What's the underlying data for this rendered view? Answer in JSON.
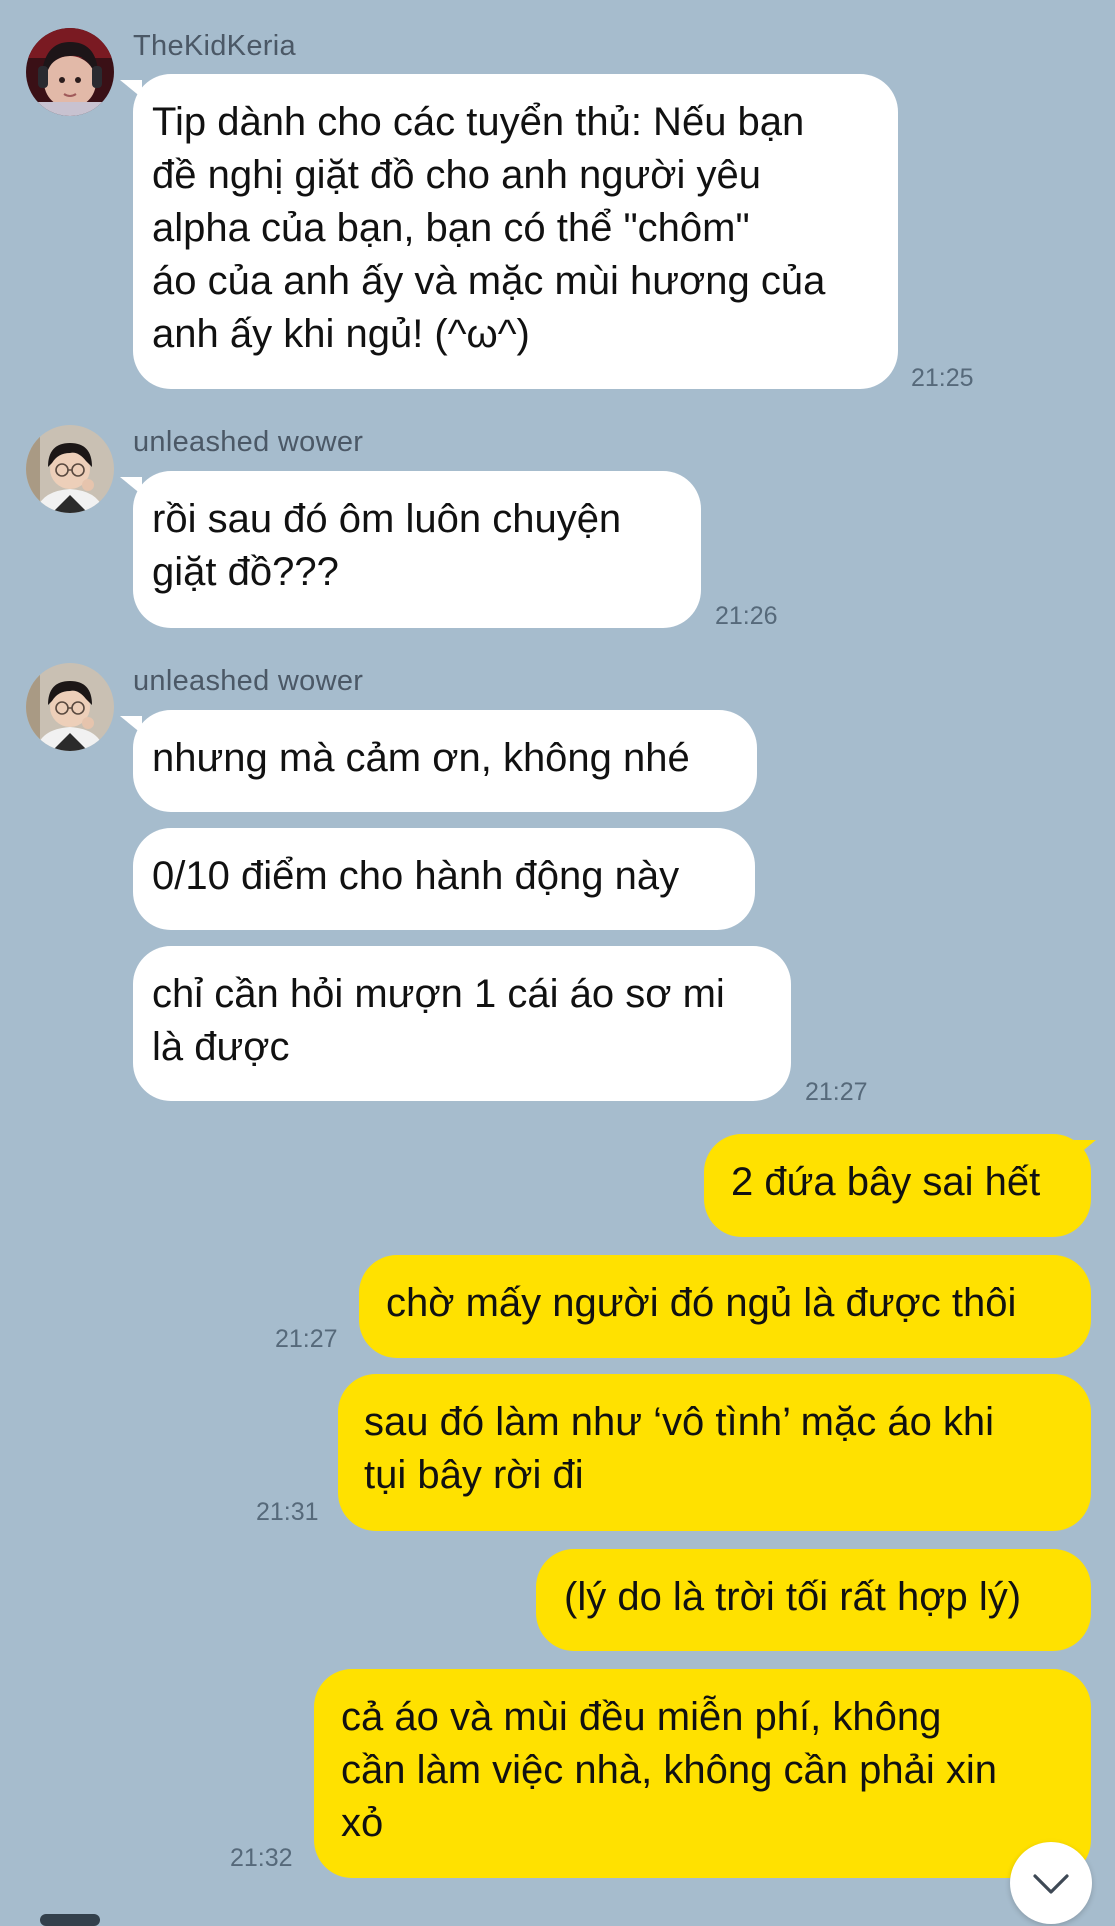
{
  "chat": {
    "thread_1": {
      "sender": "TheKidKeria",
      "text": "Tip dành cho các tuyển thủ: Nếu bạn\nđề nghị giặt đồ cho anh người yêu\nalpha của bạn, bạn có thể \"chôm\"\náo của anh ấy và mặc mùi hương của\nanh ấy khi ngủ! (^ω^)",
      "time": "21:25"
    },
    "thread_2": {
      "sender": "unleashed wower",
      "text": "rồi sau đó ôm luôn chuyện\ngiặt đồ???",
      "time": "21:26"
    },
    "thread_3": {
      "sender": "unleashed wower",
      "messages": [
        "nhưng mà cảm ơn, không nhé",
        "0/10 điểm cho hành động này",
        "chỉ cần hỏi mượn 1 cái áo sơ mi\nlà được"
      ],
      "time": "21:27"
    },
    "outgoing": {
      "messages": [
        "2 đứa bây sai hết",
        "chờ mấy người đó ngủ là được thôi",
        "sau đó làm như ‘vô tình’ mặc áo khi\ntụi bây rời đi",
        "(lý do là trời tối rất hợp lý)",
        "cả áo và mùi đều miễn phí, không\ncần làm việc nhà, không cần phải xin\nxỏ"
      ],
      "times": [
        "21:27",
        "21:31",
        "21:32"
      ]
    },
    "scroll_icon": "chevron-down-icon",
    "colors": {
      "background": "#a6bccd",
      "incoming_bubble": "#ffffff",
      "outgoing_bubble": "#ffe100"
    }
  }
}
